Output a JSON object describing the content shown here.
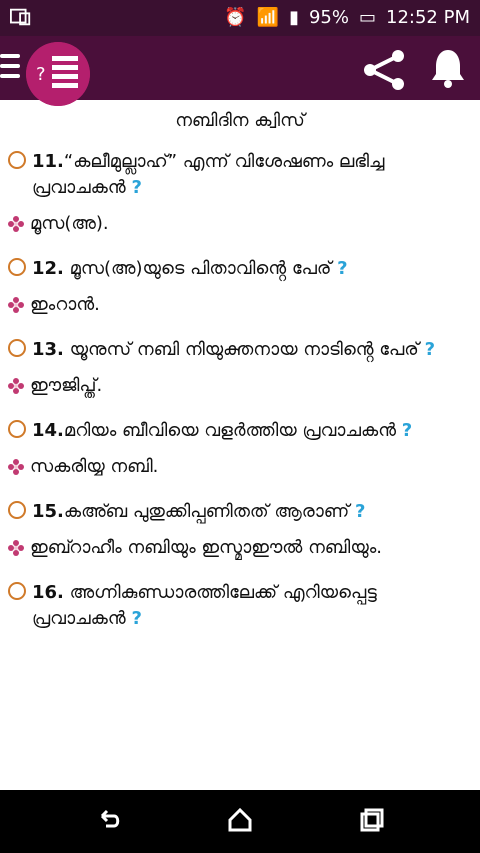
{
  "status": {
    "battery": "95%",
    "time": "12:52 PM"
  },
  "app": {
    "title": "നബിദിന ക്വിസ്"
  },
  "qa": [
    {
      "no": "11.",
      "q": "“കലീമുല്ലാഹ്” എന്ന് വിശേഷണം ലഭിച്ച പ്രവാചകൻ",
      "a": "മൂസ(അ)."
    },
    {
      "no": "12.",
      "q": " മൂസ(അ)യുടെ പിതാവിൻ്റെ പേര്",
      "a": "ഇംറാൻ."
    },
    {
      "no": "13.",
      "q": " യൂനുസ് നബി നിയുക്തനായ നാടിൻ്റെ പേര്",
      "a": "ഈജിപ്ത്."
    },
    {
      "no": "14.",
      "q": "മറിയം ബീവിയെ വളർത്തിയ പ്രവാചകൻ",
      "a": "സകരിയ്യ നബി."
    },
    {
      "no": "15.",
      "q": "കഅ്ബ പുതുക്കിപ്പണിതത് ആരാണ്",
      "a": "ഇബ്റാഹീം നബിയും ഇസ്മാഈൽ നബിയും."
    },
    {
      "no": "16.",
      "q": " അഗ്നികുണ്ഡാരത്തിലേക്ക് എറിയപ്പെട്ട പ്രവാചകൻ",
      "a": ""
    }
  ],
  "qmark": "?"
}
